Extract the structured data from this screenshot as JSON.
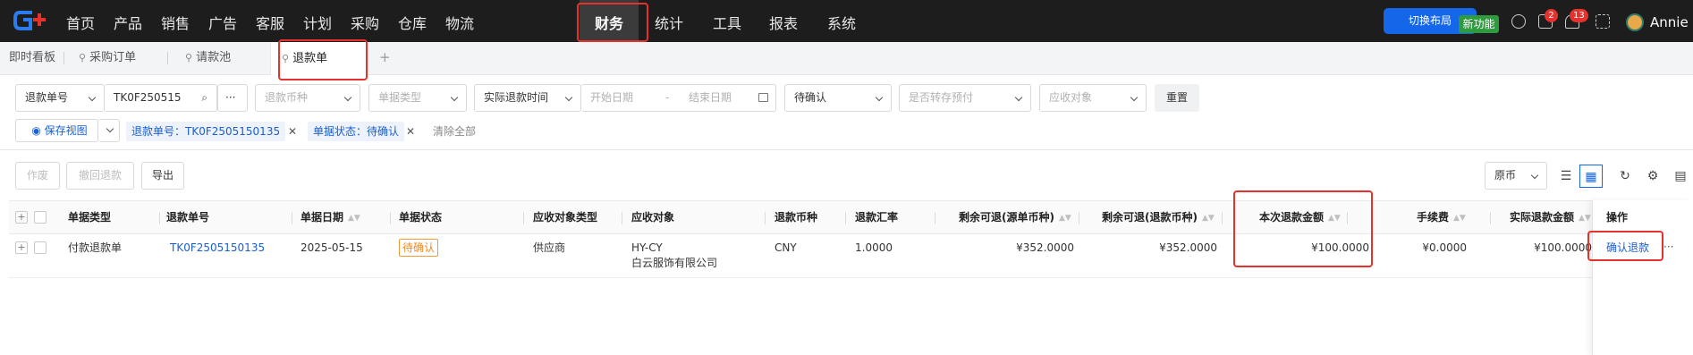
{
  "topnav": {
    "items": [
      "首页",
      "产品",
      "销售",
      "广告",
      "客服",
      "计划",
      "采购",
      "仓库",
      "物流",
      "财务",
      "统计",
      "工具",
      "报表",
      "系统"
    ],
    "active_item": "财务",
    "switch_layout": "切换布局",
    "new_feature": "新功能",
    "badge_tasks": "2",
    "badge_notifications": "13",
    "username": "Annie"
  },
  "tabs": {
    "dashboard": "即时看板",
    "purchase_order": "采购订单",
    "payment_pool": "请款池",
    "refund": "退款单",
    "add": "+"
  },
  "filters": {
    "refund_no_type": "退款单号",
    "refund_no_value": "TK0F250515",
    "more": "···",
    "currency_placeholder": "退款币种",
    "doc_type_placeholder": "单据类型",
    "time_type": "实际退款时间",
    "start_date": "开始日期",
    "date_sep": "-",
    "end_date": "结束日期",
    "status": "待确认",
    "prepay_placeholder": "是否转存预付",
    "receivable_placeholder": "应收对象",
    "reset": "重置",
    "save_view": "保存视图",
    "chip_refund_no": "退款单号：TK0F2505150135",
    "chip_status": "单据状态：待确认",
    "clear_all": "清除全部"
  },
  "toolbar": {
    "void": "作废",
    "revoke_refund": "撤回退款",
    "export": "导出",
    "currency_view": "原币"
  },
  "table": {
    "headers": {
      "doc_type": "单据类型",
      "refund_no": "退款单号",
      "doc_date": "单据日期",
      "doc_status": "单据状态",
      "receivable_type": "应收对象类型",
      "receivable": "应收对象",
      "refund_currency": "退款币种",
      "refund_rate": "退款汇率",
      "remaining_source": "剩余可退(源单币种)",
      "remaining_refund": "剩余可退(退款币种)",
      "this_refund": "本次退款金额",
      "fee": "手续费",
      "actual_refund": "实际退款金额",
      "operation": "操作"
    },
    "rows": [
      {
        "doc_type": "付款退款单",
        "refund_no": "TK0F2505150135",
        "doc_date": "2025-05-15",
        "doc_status": "待确认",
        "receivable_type": "供应商",
        "receivable_code": "HY-CY",
        "receivable_name": "白云服饰有限公司",
        "refund_currency": "CNY",
        "refund_rate": "1.0000",
        "remaining_source": "¥352.0000",
        "remaining_refund": "¥352.0000",
        "this_refund": "¥100.0000",
        "fee": "¥0.0000",
        "actual_refund": "¥100.0000",
        "confirm": "确认退款",
        "more": "···"
      }
    ]
  },
  "colors": {
    "nav_bg": "#1d1d1d",
    "accent_blue": "#1566e8",
    "highlight_red": "#e5322d",
    "status_orange": "#f08a1e",
    "new_green": "#2e9b3e"
  }
}
